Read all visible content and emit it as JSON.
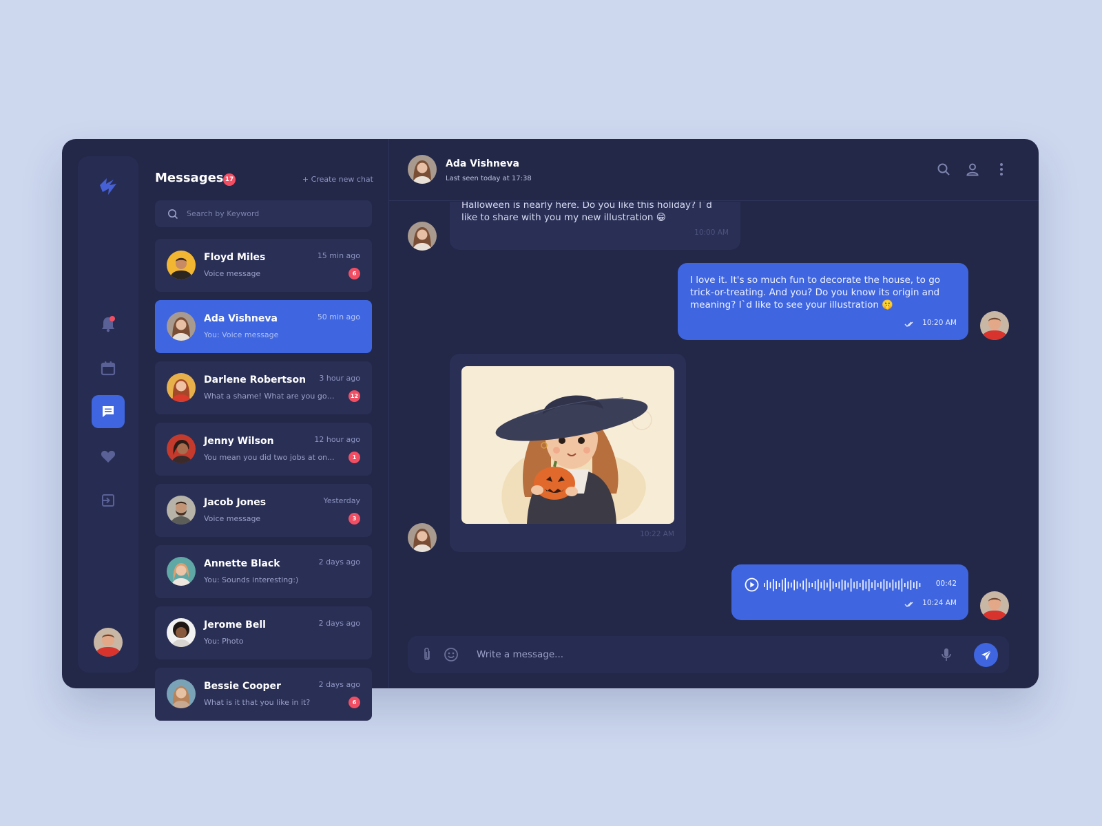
{
  "colors": {
    "accent": "#3f66e0",
    "badge": "#f24e63",
    "panel": "#232849",
    "background": "#cdd8ef"
  },
  "sidebar": {
    "icons": [
      "logo-icon",
      "bell-icon",
      "calendar-icon",
      "chat-icon",
      "heart-icon",
      "logout-icon"
    ],
    "active": "chat-icon"
  },
  "messages_panel": {
    "title": "Messages",
    "unread_total": "17",
    "create_label": "+ Create new chat",
    "search_placeholder": "Search by Keyword"
  },
  "chats": [
    {
      "name": "Floyd Miles",
      "preview": "Voice message",
      "time": "15 min ago",
      "badge": "6"
    },
    {
      "name": "Ada Vishneva",
      "preview": "You: Voice message",
      "time": "50 min ago",
      "badge": ""
    },
    {
      "name": "Darlene Robertson",
      "preview": "What a shame! What are you goi...",
      "time": "3 hour ago",
      "badge": "12"
    },
    {
      "name": "Jenny Wilson",
      "preview": "You mean you did two jobs at on...",
      "time": "12 hour ago",
      "badge": "1"
    },
    {
      "name": "Jacob Jones",
      "preview": "Voice message",
      "time": "Yesterday",
      "badge": "3"
    },
    {
      "name": "Annette Black",
      "preview": "You: Sounds interesting:)",
      "time": "2 days ago",
      "badge": ""
    },
    {
      "name": "Jerome Bell",
      "preview": "You: Photo",
      "time": "2 days ago",
      "badge": ""
    },
    {
      "name": "Bessie Cooper",
      "preview": "What is it that you like in it?",
      "time": "2 days ago",
      "badge": "6"
    }
  ],
  "conversation": {
    "name": "Ada Vishneva",
    "status": "Last seen today at 17:38",
    "messages": [
      {
        "from": "them",
        "text": "Halloween is nearly here. Do you like this holiday? I`d like to share with you my new illustration 😁",
        "time": "10:00 AM"
      },
      {
        "from": "me",
        "text": "I love it. It's so much fun to decorate the house, to go trick-or-treating. And you? Do you know its origin and meaning? I`d like to see your illustration 🤫",
        "time": "10:20 AM"
      },
      {
        "from": "them",
        "type": "image",
        "time": "10:22 AM"
      },
      {
        "from": "me",
        "type": "voice",
        "duration": "00:42",
        "time": "10:24 AM"
      }
    ],
    "composer_placeholder": "Write a message..."
  }
}
